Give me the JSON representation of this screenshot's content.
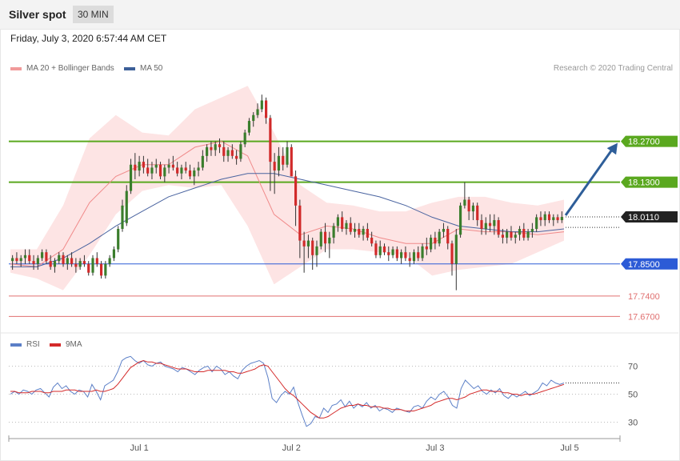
{
  "header": {
    "title": "Silver spot",
    "timeframe": "30 MIN",
    "timestamp": "Friday, July 3, 2020 6:57:44 AM CET"
  },
  "legend": {
    "items": [
      {
        "label": "MA 20 + Bollinger Bands",
        "color": "#f19a9a"
      },
      {
        "label": "MA 50",
        "color": "#3c5f98"
      }
    ],
    "credit": "Research © 2020 Trading Central"
  },
  "rsi_legend": {
    "items": [
      {
        "label": "RSI",
        "color": "#5b7fc7"
      },
      {
        "label": "9MA",
        "color": "#d42a2a"
      }
    ]
  },
  "colors": {
    "up": "#3a7d2c",
    "down": "#d12a2a",
    "resistance": "#5aa81f",
    "pivot": "#2c5bd6",
    "support": "#e07070",
    "band_fill": "#fde4e4",
    "last_price_bg": "#222222",
    "arrow": "#2e5e99"
  },
  "chart_data": [
    {
      "type": "candlestick",
      "title": "Silver spot",
      "ylim": [
        17.63,
        18.48
      ],
      "x_ticks": [
        "Jul 1",
        "Jul 2",
        "Jul 3",
        "Jul 5"
      ],
      "levels": [
        {
          "value": 18.27,
          "label": "18.2700",
          "kind": "resistance"
        },
        {
          "value": 18.13,
          "label": "18.1300",
          "kind": "resistance"
        },
        {
          "value": 17.85,
          "label": "17.8500",
          "kind": "pivot"
        },
        {
          "value": 17.74,
          "label": "17.7400",
          "kind": "support"
        },
        {
          "value": 17.67,
          "label": "17.6700",
          "kind": "support"
        }
      ],
      "last_price": {
        "value": 18.011,
        "label": "18.0110"
      },
      "ma50": [
        17.84,
        17.84,
        17.87,
        17.92,
        17.98,
        18.03,
        18.08,
        18.11,
        18.14,
        18.16,
        18.16,
        18.14,
        18.12,
        18.1,
        18.08,
        18.05,
        18.01,
        17.98,
        17.97,
        17.96,
        17.96,
        17.97
      ],
      "ma20": [
        17.85,
        17.84,
        17.9,
        18.06,
        18.15,
        18.19,
        18.19,
        18.25,
        18.27,
        18.22,
        18.02,
        17.95,
        17.98,
        17.97,
        17.94,
        17.92,
        17.92,
        17.97,
        17.96,
        17.96,
        17.95,
        17.96
      ],
      "bb_upper": [
        17.9,
        17.9,
        18.05,
        18.28,
        18.36,
        18.3,
        18.29,
        18.38,
        18.42,
        18.46,
        18.3,
        18.12,
        18.06,
        18.05,
        18.03,
        18.03,
        18.06,
        18.08,
        18.08,
        18.06,
        18.05,
        18.07
      ],
      "bb_lower": [
        17.82,
        17.8,
        17.76,
        17.88,
        18.02,
        18.1,
        18.12,
        18.11,
        18.12,
        17.98,
        17.78,
        17.84,
        17.9,
        17.9,
        17.89,
        17.88,
        17.81,
        17.83,
        17.84,
        17.85,
        17.89,
        17.93
      ],
      "candles": [
        [
          17.86,
          17.88,
          17.83,
          17.87
        ],
        [
          17.87,
          17.89,
          17.85,
          17.86
        ],
        [
          17.86,
          17.88,
          17.84,
          17.87
        ],
        [
          17.87,
          17.9,
          17.85,
          17.88
        ],
        [
          17.88,
          17.9,
          17.85,
          17.86
        ],
        [
          17.86,
          17.88,
          17.83,
          17.85
        ],
        [
          17.85,
          17.88,
          17.83,
          17.87
        ],
        [
          17.87,
          17.9,
          17.86,
          17.89
        ],
        [
          17.89,
          17.9,
          17.85,
          17.86
        ],
        [
          17.86,
          17.88,
          17.83,
          17.84
        ],
        [
          17.84,
          17.87,
          17.82,
          17.86
        ],
        [
          17.86,
          17.89,
          17.85,
          17.88
        ],
        [
          17.88,
          17.89,
          17.84,
          17.85
        ],
        [
          17.85,
          17.88,
          17.83,
          17.87
        ],
        [
          17.87,
          17.89,
          17.84,
          17.85
        ],
        [
          17.85,
          17.87,
          17.82,
          17.84
        ],
        [
          17.84,
          17.87,
          17.83,
          17.86
        ],
        [
          17.86,
          17.88,
          17.84,
          17.85
        ],
        [
          17.85,
          17.86,
          17.81,
          17.82
        ],
        [
          17.82,
          17.88,
          17.81,
          17.87
        ],
        [
          17.87,
          17.89,
          17.84,
          17.85
        ],
        [
          17.85,
          17.86,
          17.8,
          17.81
        ],
        [
          17.81,
          17.86,
          17.8,
          17.85
        ],
        [
          17.85,
          17.88,
          17.84,
          17.87
        ],
        [
          17.87,
          17.91,
          17.86,
          17.9
        ],
        [
          17.9,
          17.98,
          17.89,
          17.97
        ],
        [
          17.97,
          18.07,
          17.96,
          18.05
        ],
        [
          17.99,
          18.12,
          17.98,
          18.1
        ],
        [
          18.1,
          18.21,
          18.09,
          18.19
        ],
        [
          18.19,
          18.23,
          18.14,
          18.17
        ],
        [
          18.17,
          18.22,
          18.15,
          18.2
        ],
        [
          18.2,
          18.22,
          18.16,
          18.18
        ],
        [
          18.18,
          18.21,
          18.15,
          18.16
        ],
        [
          18.16,
          18.2,
          18.14,
          18.18
        ],
        [
          18.18,
          18.21,
          18.16,
          18.19
        ],
        [
          18.19,
          18.2,
          18.14,
          18.15
        ],
        [
          18.15,
          18.19,
          18.13,
          18.18
        ],
        [
          18.18,
          18.21,
          18.16,
          18.19
        ],
        [
          18.19,
          18.22,
          18.17,
          18.18
        ],
        [
          18.18,
          18.2,
          18.15,
          18.16
        ],
        [
          18.16,
          18.19,
          18.14,
          18.18
        ],
        [
          18.18,
          18.2,
          18.16,
          18.17
        ],
        [
          18.17,
          18.19,
          18.14,
          18.15
        ],
        [
          18.15,
          18.18,
          18.12,
          18.17
        ],
        [
          18.17,
          18.2,
          18.15,
          18.18
        ],
        [
          18.18,
          18.24,
          18.17,
          18.22
        ],
        [
          18.22,
          18.26,
          18.2,
          18.25
        ],
        [
          18.25,
          18.27,
          18.22,
          18.24
        ],
        [
          18.24,
          18.27,
          18.22,
          18.26
        ],
        [
          18.26,
          18.28,
          18.23,
          18.25
        ],
        [
          18.25,
          18.27,
          18.2,
          18.22
        ],
        [
          18.22,
          18.25,
          18.2,
          18.24
        ],
        [
          18.24,
          18.26,
          18.21,
          18.22
        ],
        [
          18.22,
          18.24,
          18.19,
          18.21
        ],
        [
          18.21,
          18.27,
          18.2,
          18.26
        ],
        [
          18.26,
          18.31,
          18.25,
          18.3
        ],
        [
          18.3,
          18.35,
          18.29,
          18.34
        ],
        [
          18.34,
          18.37,
          18.32,
          18.36
        ],
        [
          18.36,
          18.4,
          18.35,
          18.38
        ],
        [
          18.38,
          18.43,
          18.37,
          18.41
        ],
        [
          18.41,
          18.42,
          18.33,
          18.35
        ],
        [
          18.35,
          18.36,
          18.1,
          18.2
        ],
        [
          18.2,
          18.23,
          18.09,
          18.17
        ],
        [
          18.17,
          18.25,
          18.15,
          18.22
        ],
        [
          18.22,
          18.25,
          18.17,
          18.19
        ],
        [
          18.19,
          18.27,
          18.18,
          18.25
        ],
        [
          18.25,
          18.26,
          18.15,
          18.15
        ],
        [
          18.15,
          18.17,
          17.98,
          18.05
        ],
        [
          18.05,
          18.07,
          17.87,
          17.93
        ],
        [
          17.93,
          17.96,
          17.82,
          17.91
        ],
        [
          17.91,
          17.95,
          17.87,
          17.93
        ],
        [
          17.93,
          17.94,
          17.83,
          17.88
        ],
        [
          17.88,
          17.93,
          17.84,
          17.91
        ],
        [
          17.91,
          17.97,
          17.9,
          17.96
        ],
        [
          17.96,
          17.99,
          17.89,
          17.92
        ],
        [
          17.92,
          17.96,
          17.87,
          17.94
        ],
        [
          17.94,
          17.99,
          17.92,
          17.98
        ],
        [
          17.98,
          18.02,
          17.96,
          18.01
        ],
        [
          18.01,
          18.03,
          17.96,
          17.97
        ],
        [
          17.97,
          18.0,
          17.95,
          17.99
        ],
        [
          17.99,
          18.01,
          17.95,
          17.96
        ],
        [
          17.96,
          17.99,
          17.94,
          17.97
        ],
        [
          17.97,
          17.99,
          17.94,
          17.95
        ],
        [
          17.95,
          17.98,
          17.93,
          17.97
        ],
        [
          17.97,
          17.99,
          17.93,
          17.94
        ],
        [
          17.94,
          17.96,
          17.91,
          17.92
        ],
        [
          17.92,
          17.93,
          17.87,
          17.88
        ],
        [
          17.88,
          17.93,
          17.87,
          17.91
        ],
        [
          17.91,
          17.92,
          17.88,
          17.89
        ],
        [
          17.89,
          17.91,
          17.86,
          17.88
        ],
        [
          17.88,
          17.91,
          17.87,
          17.9
        ],
        [
          17.9,
          17.91,
          17.86,
          17.87
        ],
        [
          17.87,
          17.9,
          17.85,
          17.89
        ],
        [
          17.89,
          17.91,
          17.86,
          17.87
        ],
        [
          17.87,
          17.89,
          17.84,
          17.86
        ],
        [
          17.86,
          17.9,
          17.85,
          17.89
        ],
        [
          17.89,
          17.91,
          17.86,
          17.87
        ],
        [
          17.87,
          17.92,
          17.86,
          17.91
        ],
        [
          17.91,
          17.94,
          17.88,
          17.9
        ],
        [
          17.9,
          17.95,
          17.89,
          17.94
        ],
        [
          17.94,
          17.96,
          17.9,
          17.92
        ],
        [
          17.92,
          17.97,
          17.91,
          17.96
        ],
        [
          17.96,
          17.99,
          17.94,
          17.97
        ],
        [
          17.97,
          17.98,
          17.9,
          17.92
        ],
        [
          17.92,
          17.93,
          17.81,
          17.85
        ],
        [
          17.85,
          17.97,
          17.76,
          17.95
        ],
        [
          17.95,
          18.06,
          17.94,
          18.05
        ],
        [
          18.05,
          18.13,
          18.04,
          18.07
        ],
        [
          18.07,
          18.08,
          18.0,
          18.03
        ],
        [
          18.03,
          18.06,
          18.0,
          18.05
        ],
        [
          18.05,
          18.06,
          17.98,
          18.0
        ],
        [
          18.0,
          18.02,
          17.95,
          17.97
        ],
        [
          17.97,
          18.01,
          17.95,
          17.99
        ],
        [
          17.99,
          18.02,
          17.96,
          17.98
        ],
        [
          17.98,
          18.02,
          17.95,
          18.0
        ],
        [
          18.0,
          18.01,
          17.94,
          17.95
        ],
        [
          17.95,
          17.97,
          17.92,
          17.94
        ],
        [
          17.94,
          17.97,
          17.92,
          17.96
        ],
        [
          17.96,
          17.98,
          17.93,
          17.94
        ],
        [
          17.94,
          17.96,
          17.92,
          17.95
        ],
        [
          17.95,
          17.98,
          17.93,
          17.97
        ],
        [
          17.97,
          17.99,
          17.93,
          17.94
        ],
        [
          17.94,
          17.97,
          17.93,
          17.96
        ],
        [
          17.96,
          17.99,
          17.94,
          17.97
        ],
        [
          17.97,
          18.02,
          17.96,
          18.01
        ],
        [
          18.01,
          18.03,
          17.98,
          18.0
        ],
        [
          18.0,
          18.03,
          17.98,
          18.02
        ],
        [
          18.02,
          18.03,
          17.99,
          18.0
        ],
        [
          18.0,
          18.02,
          17.98,
          18.01
        ],
        [
          18.01,
          18.02,
          17.99,
          18.0
        ],
        [
          18.0,
          18.03,
          17.99,
          18.011
        ]
      ]
    },
    {
      "type": "line",
      "title": "RSI",
      "ylim": [
        20,
        80
      ],
      "y_ticks": [
        "70",
        "50",
        "30"
      ],
      "series": [
        {
          "name": "RSI",
          "values": [
            50,
            52,
            50,
            53,
            52,
            50,
            53,
            54,
            51,
            48,
            55,
            58,
            54,
            56,
            52,
            50,
            53,
            52,
            48,
            57,
            52,
            46,
            56,
            58,
            60,
            66,
            74,
            76,
            77,
            74,
            72,
            74,
            71,
            70,
            72,
            73,
            70,
            69,
            68,
            66,
            69,
            68,
            66,
            64,
            67,
            69,
            70,
            66,
            70,
            68,
            64,
            66,
            63,
            61,
            67,
            70,
            72,
            73,
            74,
            72,
            62,
            47,
            44,
            49,
            52,
            50,
            55,
            44,
            35,
            27,
            29,
            34,
            33,
            40,
            37,
            42,
            43,
            46,
            41,
            45,
            40,
            43,
            41,
            44,
            40,
            42,
            38,
            40,
            39,
            37,
            40,
            39,
            38,
            37,
            41,
            42,
            40,
            45,
            48,
            46,
            50,
            52,
            48,
            42,
            40,
            54,
            60,
            57,
            54,
            56,
            52,
            50,
            53,
            51,
            54,
            49,
            47,
            50,
            48,
            50,
            52,
            49,
            51,
            53,
            58,
            56,
            60,
            58,
            57,
            58
          ]
        },
        {
          "name": "9MA",
          "values": [
            52,
            52,
            51,
            51,
            51,
            52,
            52,
            52,
            51,
            51,
            52,
            52,
            52,
            53,
            53,
            53,
            52,
            52,
            52,
            52,
            53,
            52,
            52,
            53,
            54,
            57,
            61,
            65,
            69,
            71,
            73,
            74,
            73,
            73,
            72,
            72,
            71,
            70,
            69,
            68,
            68,
            68,
            67,
            66,
            66,
            66,
            67,
            67,
            67,
            67,
            67,
            66,
            66,
            65,
            65,
            66,
            67,
            68,
            70,
            71,
            70,
            66,
            62,
            58,
            54,
            51,
            49,
            46,
            43,
            40,
            37,
            35,
            33,
            33,
            34,
            36,
            38,
            40,
            41,
            42,
            42,
            43,
            42,
            42,
            41,
            41,
            41,
            40,
            40,
            39,
            39,
            39,
            38,
            38,
            38,
            39,
            40,
            41,
            42,
            44,
            45,
            46,
            47,
            47,
            46,
            47,
            48,
            50,
            51,
            52,
            53,
            53,
            52,
            52,
            52,
            51,
            51,
            50,
            50,
            49,
            50,
            50,
            50,
            51,
            52,
            53,
            54,
            55,
            56,
            57
          ]
        }
      ]
    }
  ]
}
